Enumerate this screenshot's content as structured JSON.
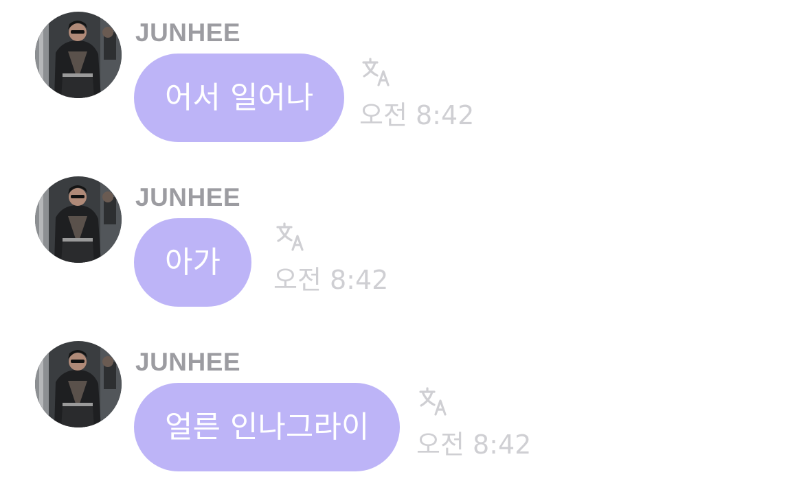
{
  "messages": [
    {
      "sender": "JUNHEE",
      "text": "어서 일어나",
      "time": "오전 8:42"
    },
    {
      "sender": "JUNHEE",
      "text": "아가",
      "time": "오전 8:42"
    },
    {
      "sender": "JUNHEE",
      "text": "얼른 인나그라이",
      "time": "오전 8:42"
    }
  ],
  "icons": {
    "translate": "translate-icon"
  },
  "colors": {
    "bubble": "#bdb4f7",
    "bubble_text": "#ffffff",
    "sender": "#9c9ca1",
    "time": "#cfcfd3",
    "icon": "#cfcfd3"
  }
}
